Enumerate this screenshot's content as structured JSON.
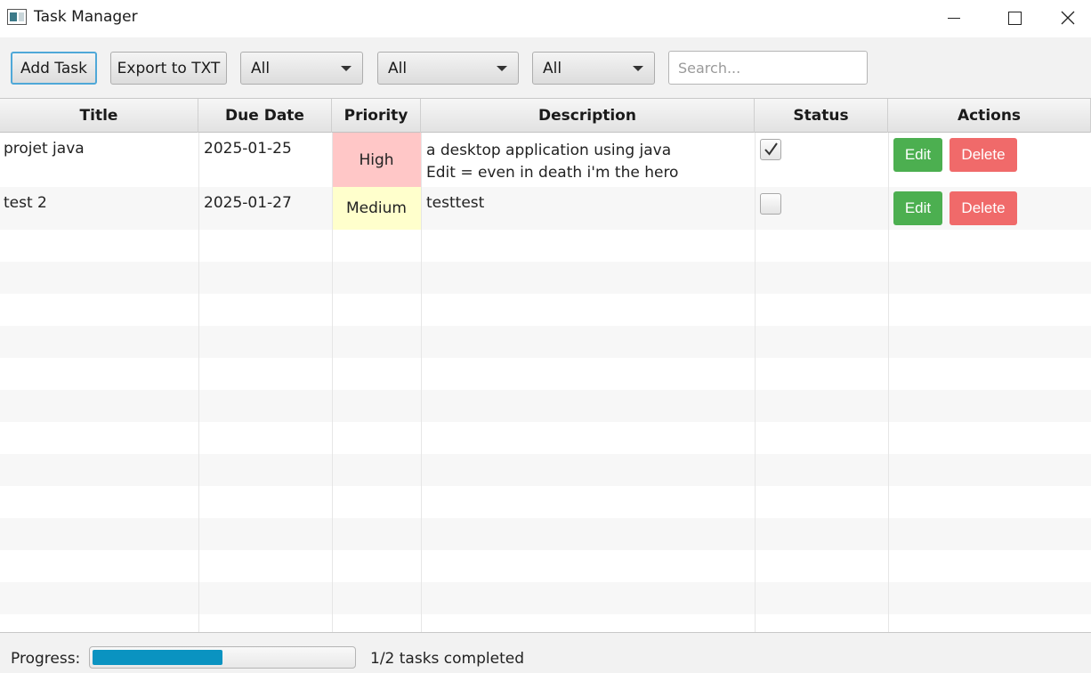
{
  "window": {
    "title": "Task Manager",
    "icon": "app-window-icon",
    "controls": [
      "minimize-icon",
      "maximize-icon",
      "close-icon"
    ]
  },
  "toolbar": {
    "add_label": "Add Task",
    "export_label": "Export to TXT",
    "filter1_value": "All",
    "filter2_value": "All",
    "filter3_value": "All",
    "search_placeholder": "Search...",
    "search_value": ""
  },
  "table": {
    "headers": [
      "Title",
      "Due Date",
      "Priority",
      "Description",
      "Status",
      "Actions"
    ],
    "rows": [
      {
        "title": "projet java",
        "due": "2025-01-25",
        "priority": "High",
        "priority_color": "#ffc7c7",
        "description_line1": "a desktop application using java",
        "description_line2": "Edit = even in death i'm the hero",
        "completed": true,
        "edit_label": "Edit",
        "delete_label": "Delete"
      },
      {
        "title": "test 2",
        "due": "2025-01-27",
        "priority": "Medium",
        "priority_color": "#ffffcc",
        "description_line1": "testtest",
        "description_line2": "",
        "completed": false,
        "edit_label": "Edit",
        "delete_label": "Delete"
      }
    ]
  },
  "footer": {
    "progress_label": "Progress:",
    "progress_fraction": 0.5,
    "progress_text": "1/2 tasks completed"
  },
  "colors": {
    "edit_button": "#4caf50",
    "delete_button": "#f06a6a",
    "progress_fill": "#0a93c1",
    "focus_border": "#4fa8d8"
  }
}
